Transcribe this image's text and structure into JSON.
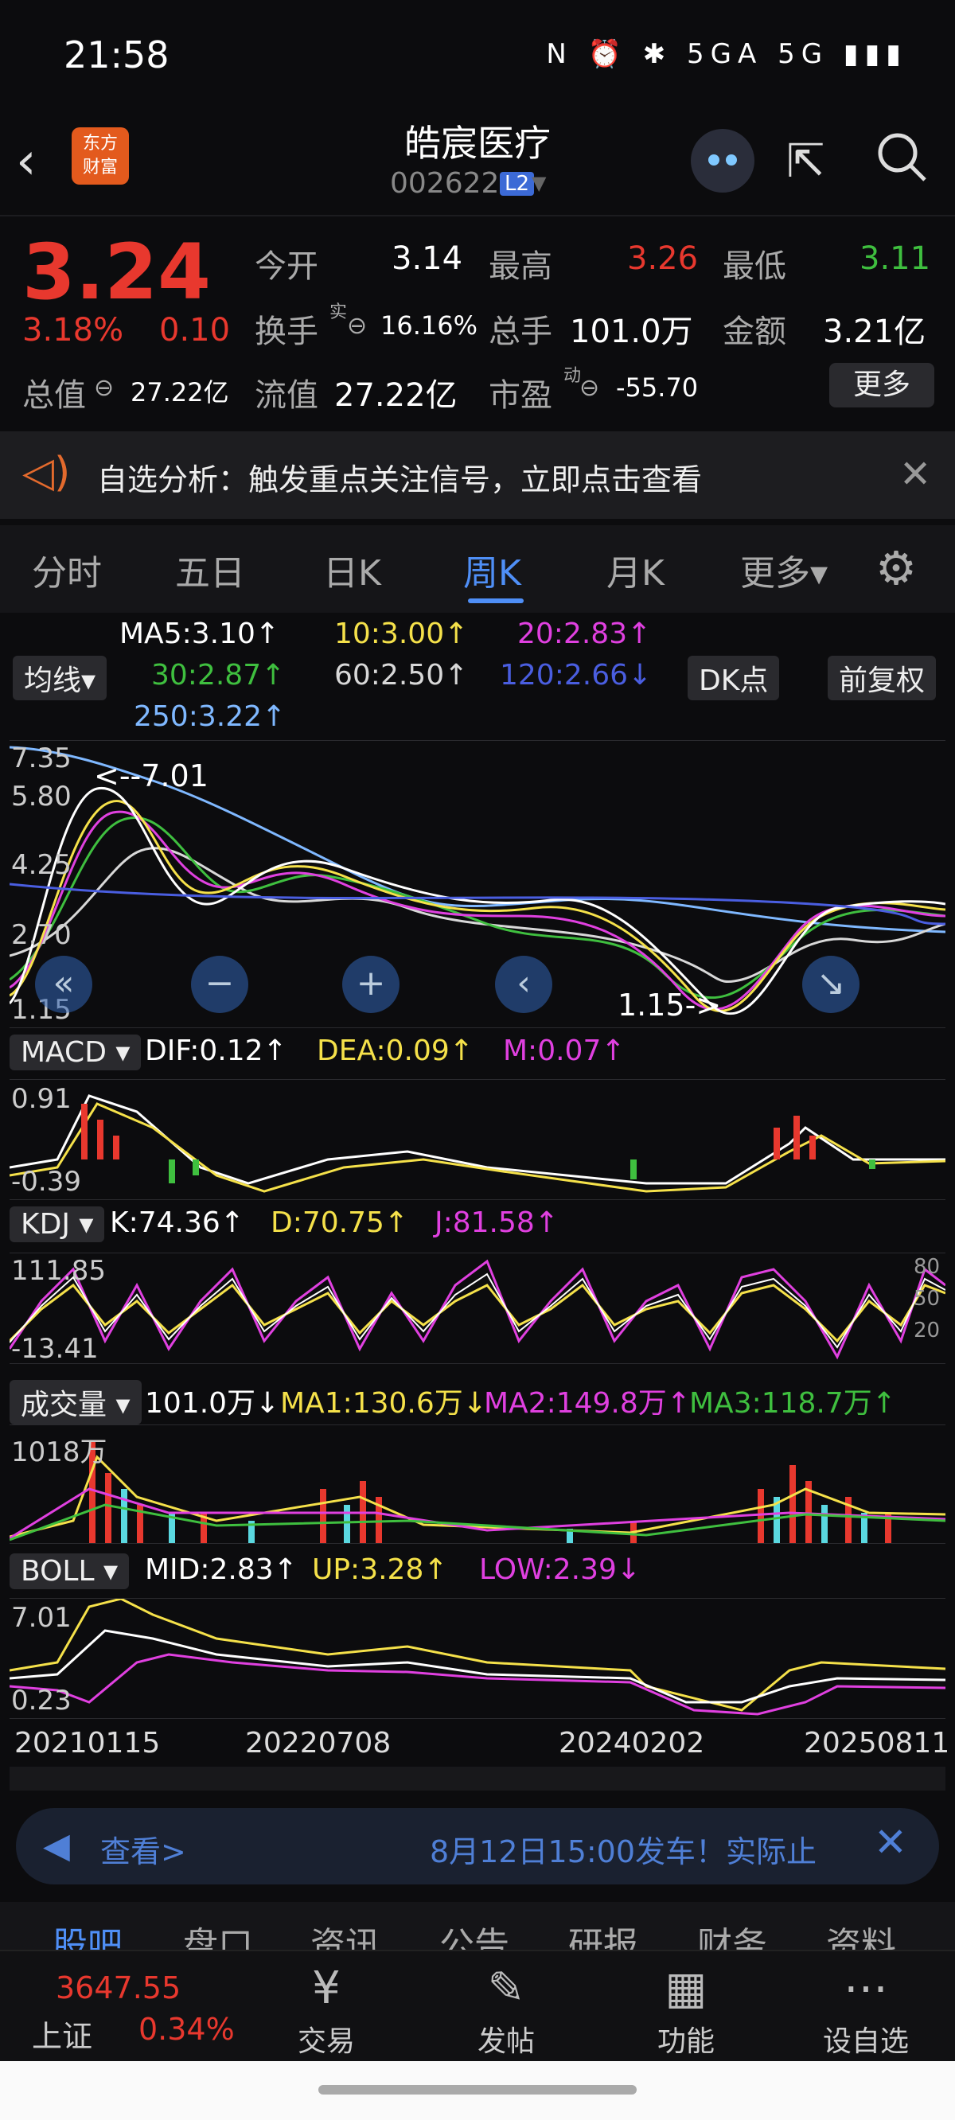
{
  "status_bar": {
    "time": "21:58",
    "icons": "N ⏰ ✱ 5GA 5G ▮▮▮"
  },
  "header": {
    "back_icon": "chevron-left-icon",
    "logo_text_1": "东方",
    "logo_text_2": "财富",
    "title": "皓宸医疗",
    "code": "002622",
    "level_badge": "L2"
  },
  "quote": {
    "price": "3.24",
    "change_pct": "3.18%",
    "change": "0.10",
    "open_label": "今开",
    "open": "3.14",
    "high_label": "最高",
    "high": "3.26",
    "low_label": "最低",
    "low": "3.11",
    "turnover_label": "换手",
    "turnover_sup": "实",
    "turnover": "16.16%",
    "volume_label": "总手",
    "volume": "101.0万",
    "amount_label": "金额",
    "amount": "3.21亿",
    "total_mv_label": "总值",
    "total_mv": "27.22亿",
    "float_mv_label": "流值",
    "float_mv": "27.22亿",
    "pe_label": "市盈",
    "pe_sup": "动",
    "pe": "-55.70",
    "more_button": "更多"
  },
  "banner": {
    "text": "自选分析：触发重点关注信号，立即点击查看"
  },
  "tabs": [
    "分时",
    "五日",
    "日K",
    "周K",
    "月K",
    "更多▾"
  ],
  "active_tab": "周K",
  "ma_row": {
    "ma_button": "均线▾",
    "ma5": "MA5:3.10↑",
    "ma10": "10:3.00↑",
    "ma20": "20:2.83↑",
    "ma30": "30:2.87↑",
    "ma60": "60:2.50↑",
    "ma120": "120:2.66↓",
    "ma250": "250:3.22↑",
    "dk_button": "DK点",
    "adjust_button": "前复权"
  },
  "kline": {
    "y_labels": [
      "7.35",
      "5.80",
      "4.25",
      "2.70",
      "1.15"
    ],
    "high_marker": "<--7.01",
    "low_marker": "1.15->"
  },
  "macd": {
    "label": "MACD",
    "dif": "DIF:0.12↑",
    "dea": "DEA:0.09↑",
    "m": "M:0.07↑",
    "y_top": "0.91",
    "y_bottom": "-0.39"
  },
  "kdj": {
    "label": "KDJ",
    "k": "K:74.36↑",
    "d": "D:70.75↑",
    "j": "J:81.58↑",
    "y_top": "111.85",
    "y_bottom": "-13.41",
    "r80": "80",
    "r50": "50",
    "r20": "20"
  },
  "vol": {
    "label": "成交量",
    "v": "101.0万↓",
    "ma1": "MA1:130.6万↓",
    "ma2": "MA2:149.8万↑",
    "ma3": "MA3:118.7万↑",
    "y_top": "1018万"
  },
  "boll": {
    "label": "BOLL",
    "mid": "MID:2.83↑",
    "up": "UP:3.28↑",
    "low": "LOW:2.39↓",
    "y_top": "7.01",
    "y_bottom": "0.23"
  },
  "dates": [
    "20210115",
    "20220708",
    "20240202",
    "20250811"
  ],
  "ad": {
    "look": "查看>",
    "msg": "8月12日15:00发车！实际止"
  },
  "sub_tabs": [
    "股吧",
    "盘口",
    "资讯",
    "公告",
    "研报",
    "财务",
    "资料"
  ],
  "index": {
    "name": "上证",
    "value": "3647.55",
    "pct": "0.34%"
  },
  "bottom_nav": [
    {
      "label": "交易",
      "icon": "¥"
    },
    {
      "label": "发帖",
      "icon": "✎"
    },
    {
      "label": "功能",
      "icon": "▦"
    },
    {
      "label": "设自选",
      "icon": "⋯"
    }
  ],
  "colors": {
    "up": "#e8382e",
    "down": "#3fbf3f",
    "accent": "#4f8ff7",
    "ma5": "#ffffff",
    "ma10": "#f5e14a",
    "ma20": "#e040e0",
    "ma30": "#3fbf3f",
    "ma60": "#d8d8d8",
    "ma120": "#4a5ee0",
    "ma250": "#7fb8ff"
  }
}
